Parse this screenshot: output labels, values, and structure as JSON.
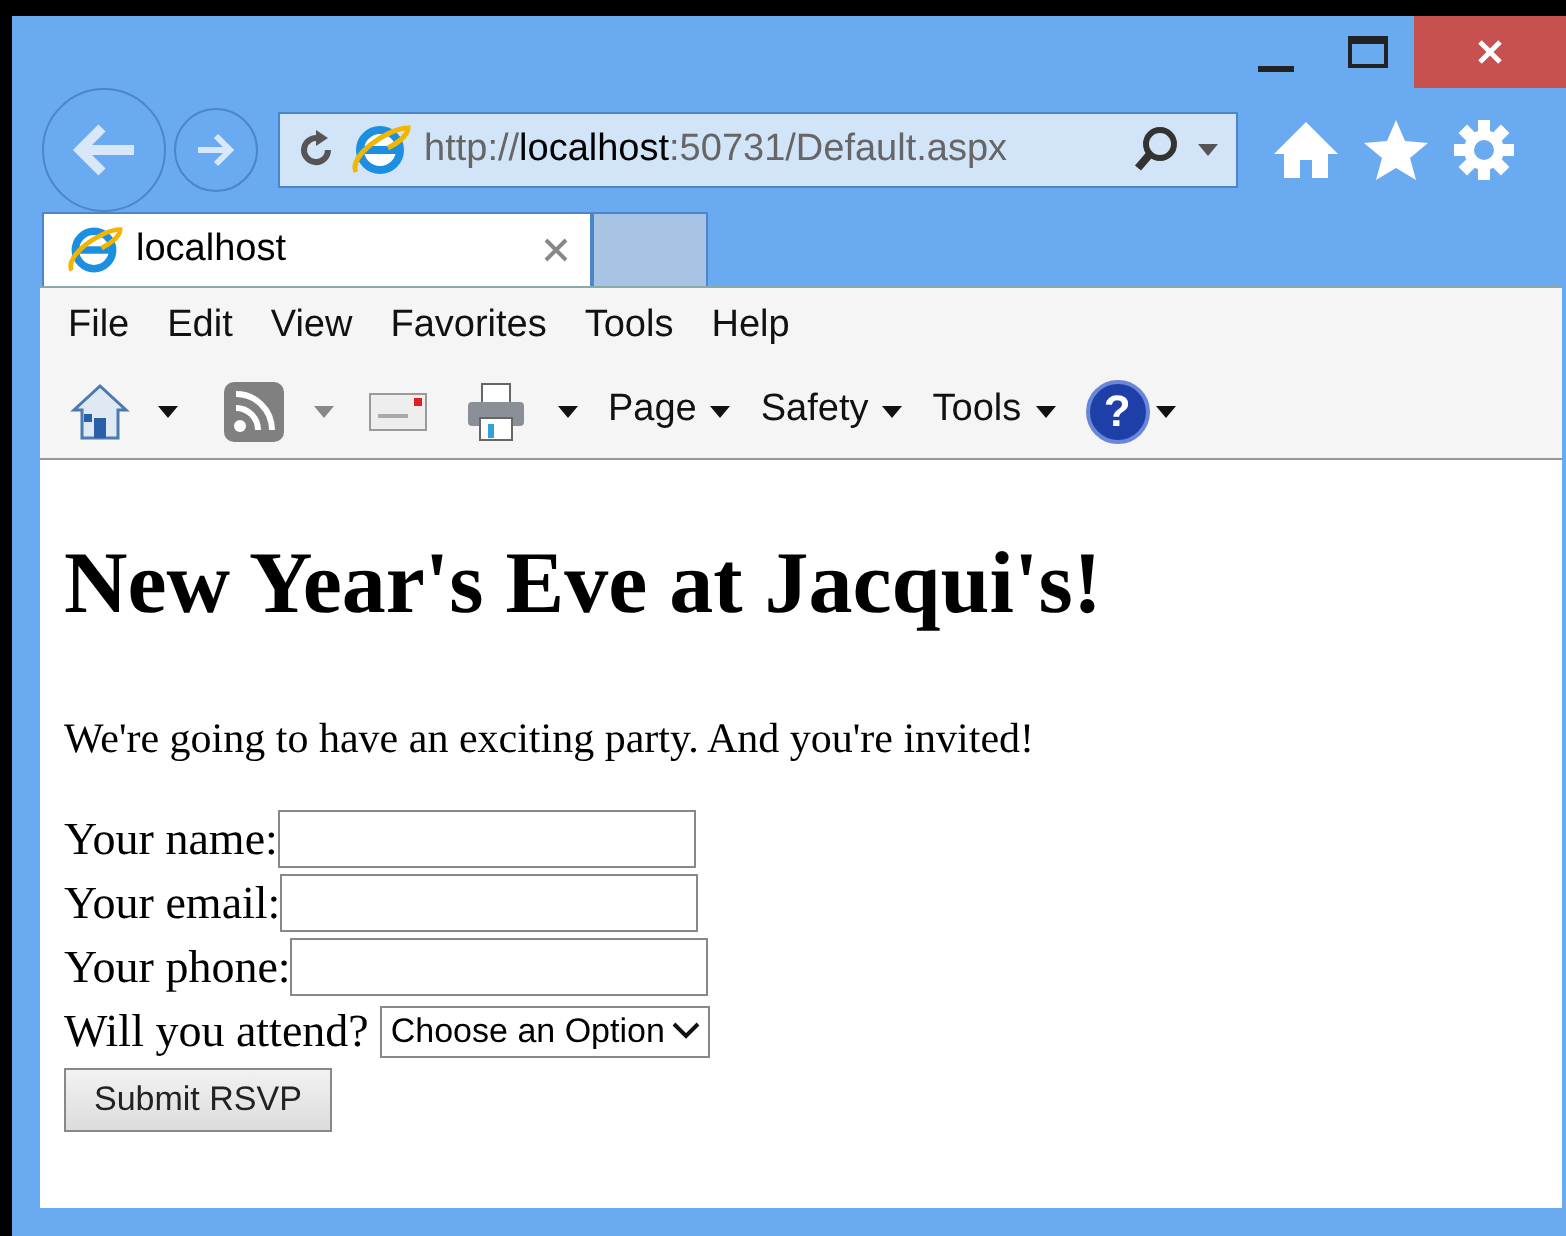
{
  "address_bar": {
    "url": "http://**localhost**:50731/Default.aspx"
  },
  "tabs": [
    {
      "label": "localhost",
      "selected": true
    }
  ],
  "menu_bar": [
    "File",
    "Edit",
    "View",
    "Favorites",
    "Tools",
    "Help"
  ],
  "command_bar": [
    "Page",
    "Safety",
    "Tools"
  ],
  "help_button": "?",
  "page": {
    "heading": "New Year's Eve at Jacqui's!",
    "intro": "We're going to have an exciting party. And you're invited!",
    "fields": [
      {
        "label": "Your name:"
      },
      {
        "label": "Your email:"
      },
      {
        "label": "Your phone:"
      }
    ],
    "select": {
      "label": "Will you attend?",
      "value": "Choose an Option"
    },
    "submit": "Submit RSVP"
  }
}
